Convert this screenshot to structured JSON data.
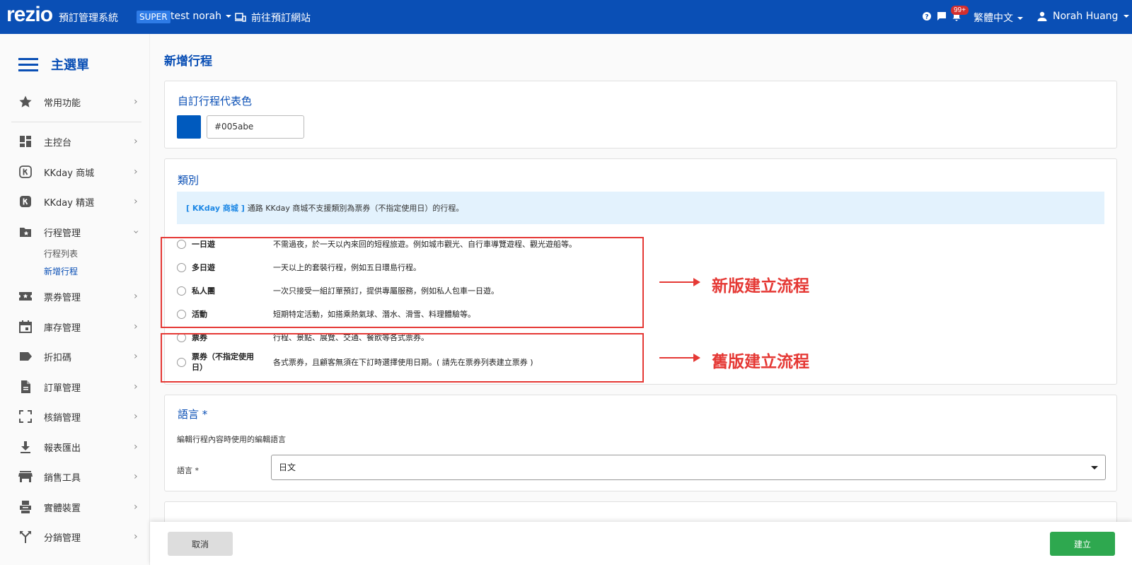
{
  "topbar": {
    "logo": "rezio",
    "system_name": "預訂管理系統",
    "role_badge": "SUPER",
    "account": "test norah",
    "goto_site": "前往預訂網站",
    "notification_count": "99+",
    "language": "繁體中文",
    "user_name": "Norah Huang",
    "bg_color": "#0a4fb5"
  },
  "sidebar": {
    "title": "主選單",
    "items": [
      {
        "label": "常用功能",
        "icon": "star-icon"
      },
      {
        "label": "主控台",
        "icon": "dashboard-icon"
      },
      {
        "label": "KKday 商城",
        "icon": "kkday-icon"
      },
      {
        "label": "KKday 精選",
        "icon": "kkday-icon"
      },
      {
        "label": "行程管理",
        "icon": "folder-star-icon",
        "expanded": true
      },
      {
        "label": "票券管理",
        "icon": "ticket-icon"
      },
      {
        "label": "庫存管理",
        "icon": "calendar-icon"
      },
      {
        "label": "折扣碼",
        "icon": "tag-icon"
      },
      {
        "label": "訂單管理",
        "icon": "document-icon"
      },
      {
        "label": "核銷管理",
        "icon": "scan-icon"
      },
      {
        "label": "報表匯出",
        "icon": "download-icon"
      },
      {
        "label": "銷售工具",
        "icon": "store-icon"
      },
      {
        "label": "實體裝置",
        "icon": "printer-icon"
      },
      {
        "label": "分銷管理",
        "icon": "split-icon"
      }
    ],
    "subitems": [
      {
        "label": "行程列表",
        "active": false
      },
      {
        "label": "新增行程",
        "active": true
      }
    ]
  },
  "main": {
    "page_title": "新增行程",
    "color_card": {
      "title": "自訂行程代表色",
      "value": "#005abe",
      "input_value": "#005abe"
    },
    "category_card": {
      "title": "類別",
      "alert_tag": "[ KKday 商城 ]",
      "alert_text": "通路 KKday 商城不支援類別為票券（不指定使用日）的行程。",
      "options": [
        {
          "label": "一日遊",
          "desc": "不需過夜，於一天以內來回的短程旅遊。例如城市觀光、自行車導覽遊程、觀光遊船等。"
        },
        {
          "label": "多日遊",
          "desc": "一天以上的套裝行程，例如五日環島行程。"
        },
        {
          "label": "私人團",
          "desc": "一次只接受一組訂單預訂，提供專屬服務，例如私人包車一日遊。"
        },
        {
          "label": "活動",
          "desc": "短期特定活動，如搭乘熱氣球、潛水、滑雪、料理體驗等。"
        },
        {
          "label": "票券",
          "desc": "行程、景點、展覽、交通、餐飲等各式票券。"
        },
        {
          "label": "票券（不指定使用日）",
          "desc": "各式票券，且顧客無須在下訂時選擇使用日期。( 請先在票券列表建立票券 )"
        }
      ],
      "annotation_new": "新版建立流程",
      "annotation_old": "舊版建立流程"
    },
    "language_card": {
      "title": "語言 *",
      "subtitle": "編輯行程內容時使用的編輯語言",
      "field_label": "語言 *",
      "selected": "日文"
    }
  },
  "footer": {
    "cancel": "取消",
    "create": "建立"
  },
  "colors": {
    "primary": "#0a4fb5",
    "accent_green": "#2ea84f",
    "annotation_red": "#e53935"
  }
}
